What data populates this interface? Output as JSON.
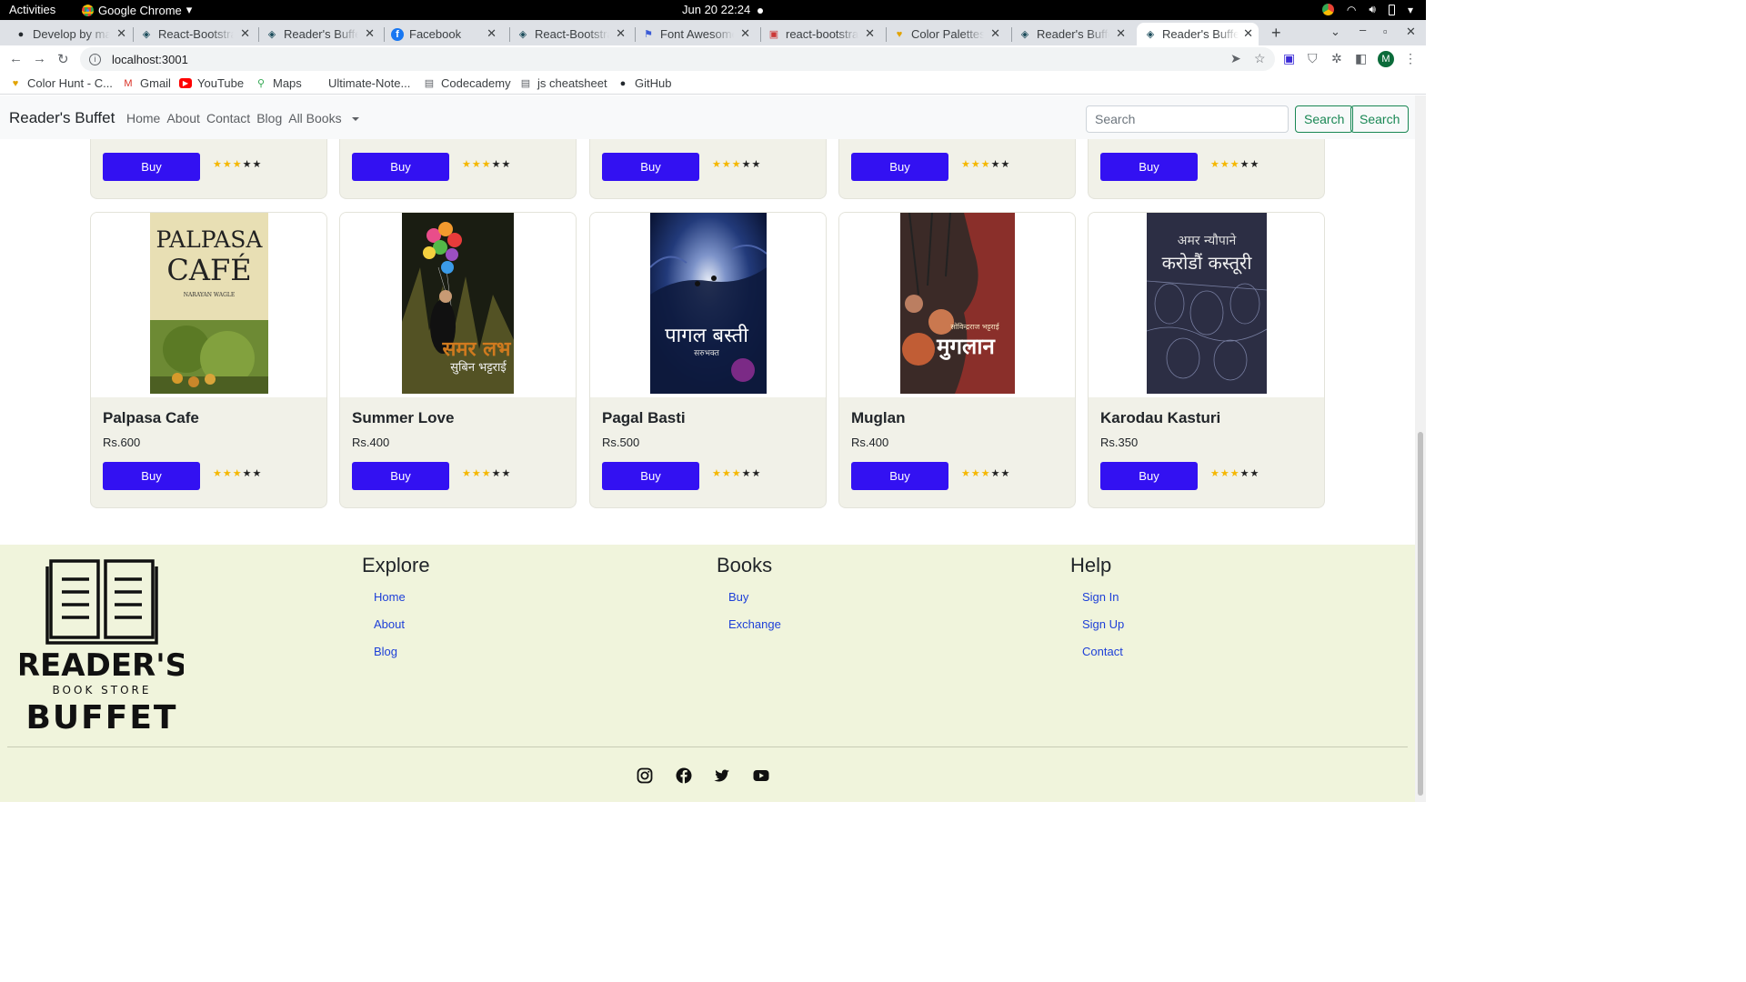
{
  "system": {
    "activities": "Activities",
    "app_name": "Google Chrome",
    "clock": "Jun 20  22:24"
  },
  "browser": {
    "tabs": [
      {
        "label": "Develop by mar",
        "icon": "github-icon"
      },
      {
        "label": "React-Bootstra",
        "icon": "react-icon"
      },
      {
        "label": "Reader's Buffe",
        "icon": "react-icon"
      },
      {
        "label": "Facebook",
        "icon": "facebook-icon"
      },
      {
        "label": "React-Bootstra",
        "icon": "react-icon"
      },
      {
        "label": "Font Awesome",
        "icon": "flag-icon"
      },
      {
        "label": "react-bootstrap",
        "icon": "npm-icon"
      },
      {
        "label": "Color Palettes f",
        "icon": "colorhunt-icon"
      },
      {
        "label": "Reader's Buffet",
        "icon": "react-icon"
      },
      {
        "label": "Reader's Buffe",
        "icon": "react-icon",
        "active": true
      }
    ],
    "url": "localhost:3001",
    "avatar_letter": "M",
    "bookmarks": [
      {
        "label": "Color Hunt - C...",
        "icon": "colorhunt-icon"
      },
      {
        "label": "Gmail",
        "icon": "gmail-icon"
      },
      {
        "label": "YouTube",
        "icon": "youtube-icon"
      },
      {
        "label": "Maps",
        "icon": "maps-icon"
      },
      {
        "label": "Ultimate-Note...",
        "icon": "none"
      },
      {
        "label": "Codecademy",
        "icon": "page-icon"
      },
      {
        "label": "js cheatsheet",
        "icon": "page-icon"
      },
      {
        "label": "GitHub",
        "icon": "github-icon"
      }
    ]
  },
  "site": {
    "brand": "Reader's Buffet",
    "nav": [
      "Home",
      "About",
      "Contact",
      "Blog"
    ],
    "dropdown": "All Books",
    "search_placeholder": "Search",
    "search_buttons": [
      "Search",
      "Search"
    ],
    "buy_label": "Buy",
    "rating": {
      "stars_filled": 3,
      "stars_total": 5
    },
    "books": [
      {
        "title": "Palpasa Cafe",
        "price": "Rs.600",
        "cover_lines": [
          "PALPASA",
          "CAFÉ",
          "NARAYAN WAGLE"
        ]
      },
      {
        "title": "Summer Love",
        "price": "Rs.400",
        "cover_lines": [
          "समर लभ",
          "सुबिन भट्टराई"
        ]
      },
      {
        "title": "Pagal Basti",
        "price": "Rs.500",
        "cover_lines": [
          "पागल बस्ती",
          "सरुभक्त"
        ]
      },
      {
        "title": "Muglan",
        "price": "Rs.400",
        "cover_lines": [
          "सोविन्द्रराज भट्टराई",
          "मुगलान"
        ]
      },
      {
        "title": "Karodau Kasturi",
        "price": "Rs.350",
        "cover_lines": [
          "अमर न्यौपाने",
          "करोडौं कस्तूरी"
        ]
      }
    ]
  },
  "footer": {
    "logo_lines": [
      "READER'S",
      "BOOK STORE",
      "BUFFET"
    ],
    "columns": [
      {
        "heading": "Explore",
        "links": [
          "Home",
          "About",
          "Blog"
        ]
      },
      {
        "heading": "Books",
        "links": [
          "Buy",
          "Exchange"
        ]
      },
      {
        "heading": "Help",
        "links": [
          "Sign In",
          "Sign Up",
          "Contact"
        ]
      }
    ],
    "social": [
      "instagram-icon",
      "facebook-icon",
      "twitter-icon",
      "youtube-icon"
    ]
  }
}
